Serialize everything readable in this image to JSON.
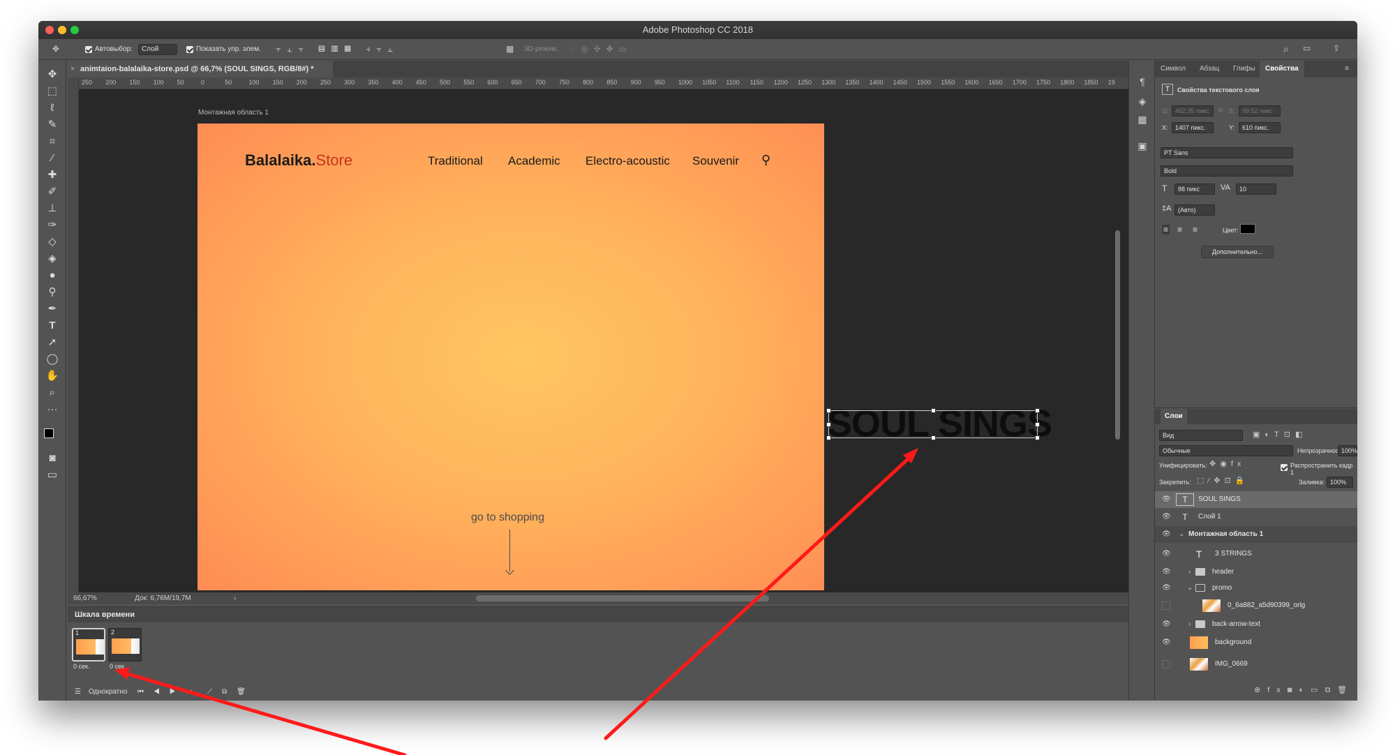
{
  "window": {
    "title": "Adobe Photoshop CC 2018"
  },
  "options_bar": {
    "autoselect_label": "Автовыбор:",
    "autoselect_value": "Слой",
    "show_transform_label": "Показать упр. элем.",
    "mode_3d_label": "3D-режим:"
  },
  "document_tab": {
    "title": "animtaion-balalaika-store.psd @ 66,7% (SOUL SINGS, RGB/8#) *"
  },
  "ruler": {
    "ticks": [
      "250",
      "200",
      "150",
      "100",
      "50",
      "0",
      "50",
      "100",
      "150",
      "200",
      "250",
      "300",
      "350",
      "400",
      "450",
      "500",
      "550",
      "600",
      "650",
      "700",
      "750",
      "800",
      "850",
      "900",
      "950",
      "1000",
      "1050",
      "1100",
      "1150",
      "1200",
      "1250",
      "1300",
      "1350",
      "1400",
      "1450",
      "1500",
      "1550",
      "1600",
      "1650",
      "1700",
      "1750",
      "1800",
      "1850",
      "19"
    ]
  },
  "artboard": {
    "label": "Монтажная область 1",
    "logo_main": "Balalaika.",
    "logo_accent": "Store",
    "nav": [
      "Traditional",
      "Academic",
      "Electro-acoustic",
      "Souvenir"
    ],
    "cta": "go to shopping",
    "colors": {
      "gradient_center": "#ffc661",
      "gradient_edge": "#ff8c54",
      "logo_accent": "#c9341b"
    }
  },
  "canvas_text": {
    "selected_text": "SOUL SINGS"
  },
  "status_bar": {
    "zoom": "66,67%",
    "doc_size": "Док: 6,76M/19,7M"
  },
  "timeline": {
    "title": "Шкала времени",
    "frames": [
      {
        "number": "1",
        "delay": "0 сек."
      },
      {
        "number": "2",
        "delay": "0 сек."
      }
    ],
    "loop": "Однократно"
  },
  "properties_panel": {
    "tabs": [
      "Символ",
      "Абзац",
      "Глифы",
      "Свойства"
    ],
    "active_tab": "Свойства",
    "header": "Свойства текстового слоя",
    "w_label": "Ш:",
    "w_value": "462,35 пикс",
    "h_label": "В:",
    "h_value": "99,52 пикс",
    "x_label": "X:",
    "x_value": "1407 пикс.",
    "y_label": "Y:",
    "y_value": "610 пикс.",
    "font_family": "PT Sans",
    "font_style": "Bold",
    "font_size": "88 пикс",
    "tracking": "10",
    "leading": "(Авто)",
    "color_label": "Цвет:",
    "more_button": "Дополнительно..."
  },
  "layers_panel": {
    "title": "Слои",
    "filter": "Вид",
    "blend_mode": "Обычные",
    "opacity_label": "Непрозрачность:",
    "opacity_value": "100%",
    "unify_label": "Унифицировать:",
    "propagate_label": "Распространить кадр 1",
    "lock_label": "Закрепить:",
    "fill_label": "Заливка:",
    "fill_value": "100%",
    "layers": [
      {
        "name": "SOUL SINGS",
        "kind": "text",
        "visible": true
      },
      {
        "name": "Слой 1",
        "kind": "text",
        "visible": true
      },
      {
        "name": "Монтажная область 1",
        "kind": "artboard",
        "visible": true
      },
      {
        "name": "3 STRINGS",
        "kind": "text",
        "visible": true
      },
      {
        "name": "header",
        "kind": "group",
        "visible": true
      },
      {
        "name": "promo",
        "kind": "group",
        "visible": true
      },
      {
        "name": "0_6a882_a5d90399_orig",
        "kind": "image",
        "visible": false
      },
      {
        "name": "back-arrow-text",
        "kind": "group",
        "visible": true
      },
      {
        "name": "background",
        "kind": "image",
        "visible": true
      },
      {
        "name": "IMG_0669",
        "kind": "image",
        "visible": false
      }
    ]
  },
  "annotation": {
    "arrow_color": "#ff1a1a"
  }
}
